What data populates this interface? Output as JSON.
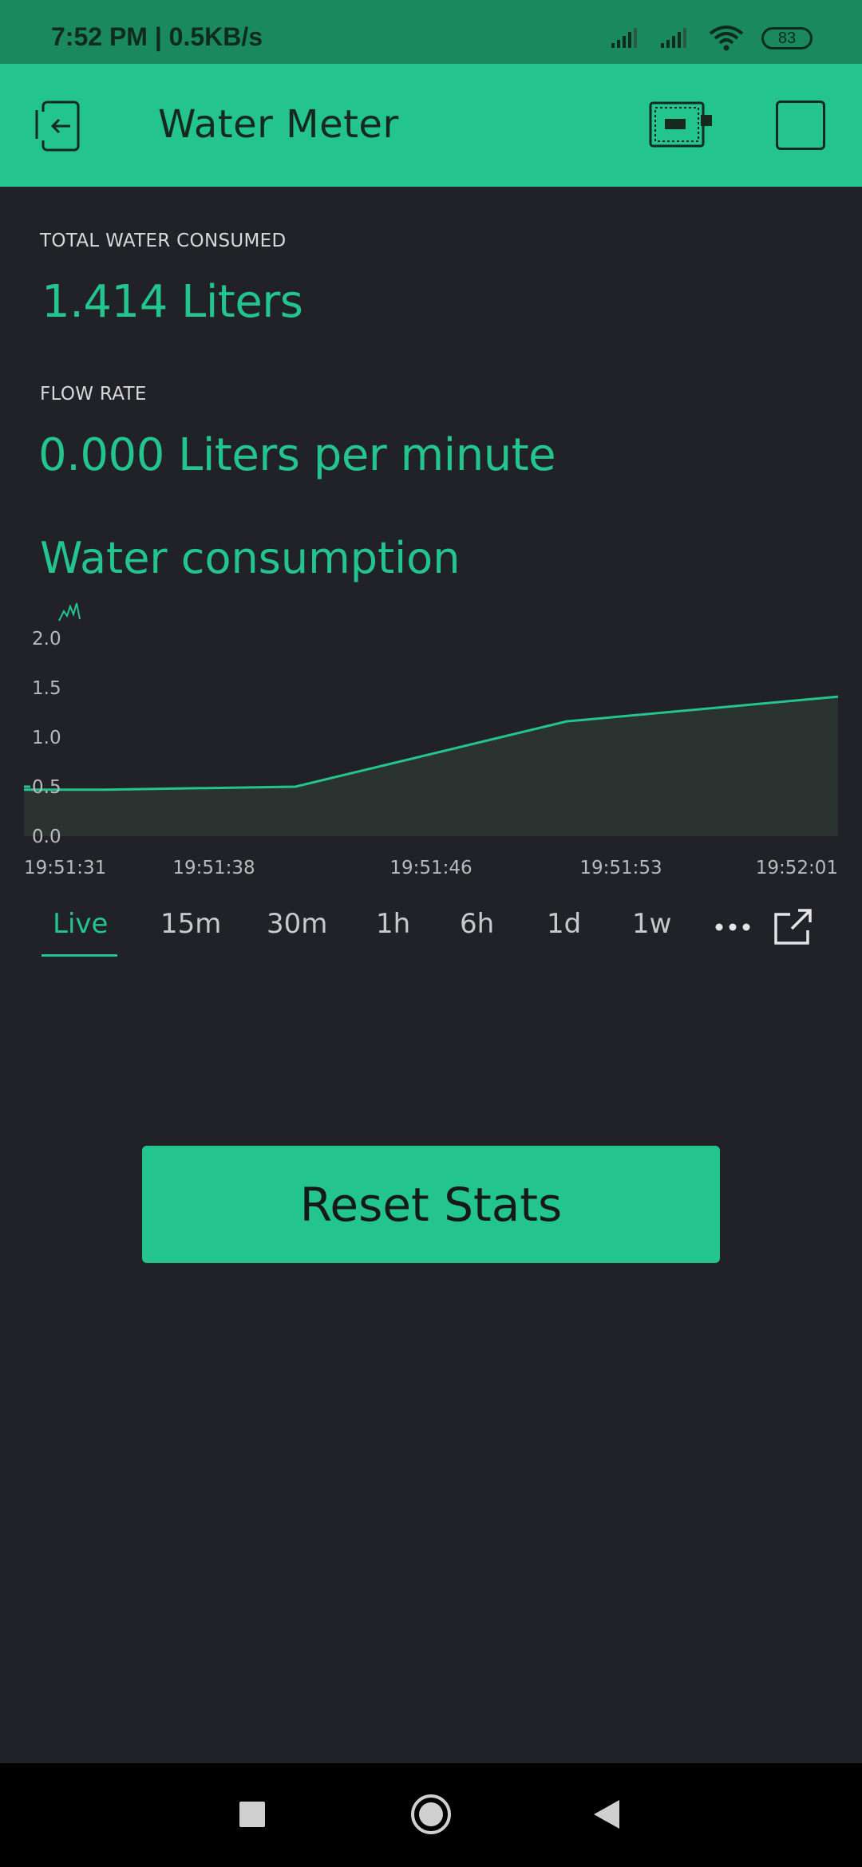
{
  "status_bar": {
    "time": "7:52 PM | 0.5KB/s",
    "battery": "83"
  },
  "app_bar": {
    "title": "Water Meter",
    "icons": [
      "back-exit-icon",
      "device-chip-icon",
      "square-icon"
    ]
  },
  "metrics": {
    "total_label": "TOTAL WATER CONSUMED",
    "total_value": "1.414 Liters",
    "flow_label": "FLOW RATE",
    "flow_value": "0.000 Liters per minute"
  },
  "chart": {
    "title": "Water consumption"
  },
  "chart_data": {
    "type": "area",
    "x": [
      "19:51:31",
      "19:51:34",
      "19:51:41",
      "19:51:51",
      "19:52:01"
    ],
    "values": [
      0.47,
      0.47,
      0.5,
      1.16,
      1.41
    ],
    "ylim": [
      0.0,
      2.0
    ],
    "y_ticks": [
      "2.0",
      "1.5",
      "1.0",
      "0.5",
      "0.0"
    ],
    "x_ticks": [
      "19:51:31",
      "19:51:38",
      "19:51:46",
      "19:51:53",
      "19:52:01"
    ],
    "line_color": "#23c48e",
    "fill_color": "#2a3330",
    "grid": false
  },
  "tabs": {
    "items": [
      "Live",
      "15m",
      "30m",
      "1h",
      "6h",
      "1d",
      "1w"
    ],
    "active": "Live"
  },
  "reset_button": {
    "label": "Reset Stats"
  },
  "colors": {
    "accent": "#23c48e",
    "background": "#212227",
    "status_bar": "#1a8a5e"
  }
}
